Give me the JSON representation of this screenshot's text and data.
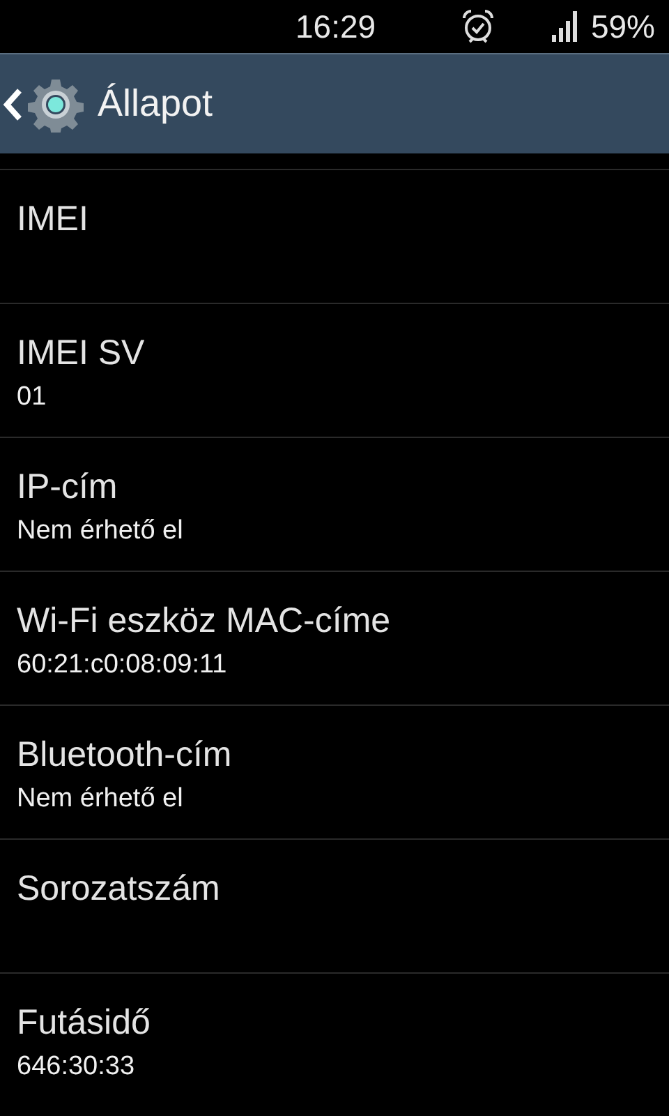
{
  "status_bar": {
    "time": "16:29",
    "battery": "59%"
  },
  "header": {
    "title": "Állapot"
  },
  "items": [
    {
      "title": "IMEI"
    },
    {
      "title": "IMEI SV",
      "value": "01"
    },
    {
      "title": "IP-cím",
      "value": "Nem érhető el"
    },
    {
      "title": "Wi-Fi eszköz MAC-címe",
      "value": "60:21:c0:08:09:11"
    },
    {
      "title": "Bluetooth-cím",
      "value": "Nem érhető el"
    },
    {
      "title": "Sorozatszám"
    },
    {
      "title": "Futásidő",
      "value": "646:30:33"
    }
  ]
}
